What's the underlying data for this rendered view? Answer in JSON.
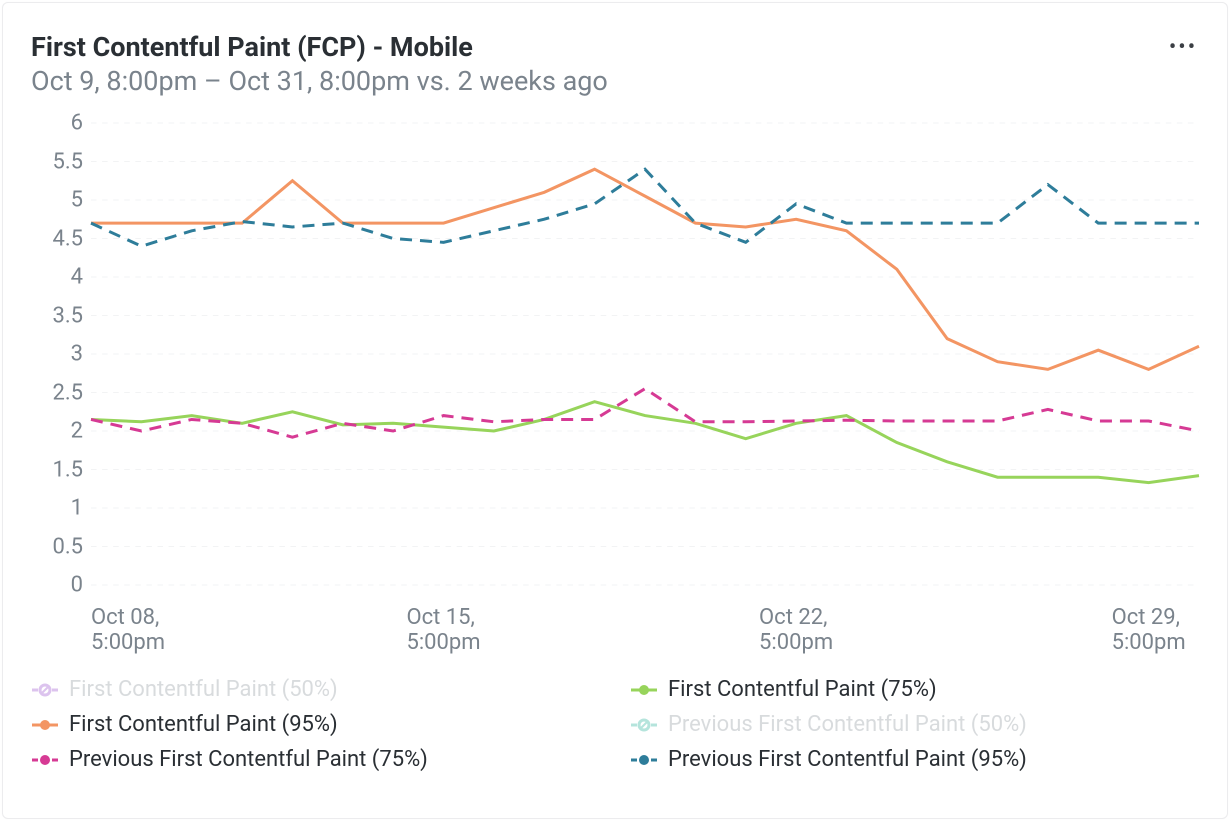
{
  "header": {
    "title": "First Contentful Paint (FCP) - Mobile",
    "subtitle": "Oct 9, 8:00pm – Oct 31, 8:00pm vs. 2 weeks ago",
    "menu_label": "More options"
  },
  "chart_data": {
    "type": "line",
    "xlabel": "",
    "ylabel": "",
    "ylim": [
      0,
      6
    ],
    "y_ticks": [
      0,
      0.5,
      1,
      1.5,
      2,
      2.5,
      3,
      3.5,
      4,
      4.5,
      5,
      5.5,
      6
    ],
    "x_ticks": [
      {
        "index": 0,
        "line1": "Oct 08,",
        "line2": "5:00pm"
      },
      {
        "index": 7,
        "line1": "Oct 15,",
        "line2": "5:00pm"
      },
      {
        "index": 14,
        "line1": "Oct 22,",
        "line2": "5:00pm"
      },
      {
        "index": 21,
        "line1": "Oct 29,",
        "line2": "5:00pm"
      }
    ],
    "n_points": 23,
    "series": [
      {
        "key": "p50",
        "name": "First Contentful Paint (50%)",
        "color": "#a564d3",
        "dashed": true,
        "empty": true,
        "values": null
      },
      {
        "key": "p75",
        "name": "First Contentful Paint (75%)",
        "color": "#97d45b",
        "dashed": false,
        "empty": false,
        "values": [
          2.15,
          2.12,
          2.2,
          2.1,
          2.25,
          2.08,
          2.1,
          2.05,
          2.0,
          2.15,
          2.38,
          2.2,
          2.1,
          1.9,
          2.1,
          2.2,
          1.85,
          1.6,
          1.4,
          1.4,
          1.4,
          1.33,
          1.42
        ]
      },
      {
        "key": "p95",
        "name": "First Contentful Paint (95%)",
        "color": "#f39563",
        "dashed": false,
        "empty": false,
        "values": [
          4.7,
          4.7,
          4.7,
          4.7,
          5.25,
          4.7,
          4.7,
          4.7,
          4.9,
          5.1,
          5.4,
          5.05,
          4.7,
          4.65,
          4.75,
          4.6,
          4.1,
          3.2,
          2.9,
          2.8,
          3.05,
          2.8,
          3.1
        ]
      },
      {
        "key": "prev_p50",
        "name": "Previous First Contentful Paint (50%)",
        "color": "#3fb9a5",
        "dashed": true,
        "empty": true,
        "values": null
      },
      {
        "key": "prev_p75",
        "name": "Previous First Contentful Paint (75%)",
        "color": "#d63a94",
        "dashed": true,
        "empty": false,
        "values": [
          2.15,
          2.0,
          2.15,
          2.1,
          1.92,
          2.1,
          2.0,
          2.2,
          2.12,
          2.15,
          2.15,
          2.55,
          2.12,
          2.12,
          2.13,
          2.14,
          2.13,
          2.13,
          2.13,
          2.28,
          2.13,
          2.13,
          2.0
        ]
      },
      {
        "key": "prev_p95",
        "name": "Previous First Contentful Paint (95%)",
        "color": "#2e7d9a",
        "dashed": true,
        "empty": false,
        "values": [
          4.7,
          4.4,
          4.6,
          4.72,
          4.65,
          4.7,
          4.5,
          4.45,
          4.6,
          4.75,
          4.95,
          5.4,
          4.7,
          4.45,
          4.95,
          4.7,
          4.7,
          4.7,
          4.7,
          5.2,
          4.7,
          4.7,
          4.7
        ]
      }
    ],
    "legend_order": [
      "p50",
      "p75",
      "p95",
      "prev_p50",
      "prev_p75",
      "prev_p95"
    ]
  }
}
